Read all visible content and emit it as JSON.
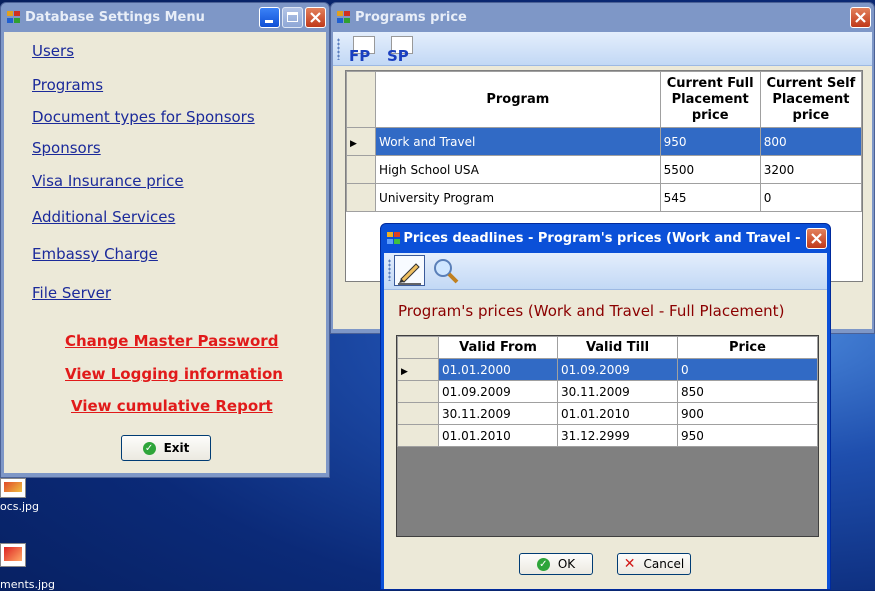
{
  "settings": {
    "title": "Database Settings Menu",
    "links": [
      "Users",
      "Programs",
      "Document types for Sponsors",
      "Sponsors",
      "Visa Insurance price",
      "Additional Services",
      "Embassy Charge",
      "File Server"
    ],
    "red_links": [
      "Change Master Password",
      "View Logging information",
      "View cumulative Report"
    ],
    "exit_label": "Exit"
  },
  "programs": {
    "title": "Programs price",
    "toolbar": [
      "FP",
      "SP"
    ],
    "columns": [
      "Program",
      "Current Full Placement price",
      "Current Self Placement price"
    ],
    "rows": [
      {
        "program": "Work and Travel",
        "full": "950",
        "self": "800"
      },
      {
        "program": "High School USA",
        "full": "5500",
        "self": "3200"
      },
      {
        "program": "University Program",
        "full": "545",
        "self": "0"
      }
    ]
  },
  "deadlines": {
    "title": "Prices deadlines -  Program's prices (Work and Travel - Full P...",
    "heading": "Program's prices (Work and Travel - Full Placement)",
    "columns": [
      "Valid From",
      "Valid Till",
      "Price"
    ],
    "rows": [
      {
        "from": "01.01.2000",
        "till": "01.09.2009",
        "price": "0"
      },
      {
        "from": "01.09.2009",
        "till": "30.11.2009",
        "price": "850"
      },
      {
        "from": "30.11.2009",
        "till": "01.01.2010",
        "price": "900"
      },
      {
        "from": "01.01.2010",
        "till": "31.12.2999",
        "price": "950"
      }
    ],
    "ok_label": "OK",
    "cancel_label": "Cancel"
  },
  "desktop": {
    "icons": [
      "ocs.jpg",
      "ments.jpg"
    ]
  },
  "colors": {
    "selection": "#316ac5",
    "link": "#1b2a9a",
    "red_link": "#e11a1a",
    "heading": "#8b0000"
  },
  "icons": [
    "minimize-icon",
    "maximize-icon",
    "close-icon",
    "edit-pencil-icon",
    "search-magnifier-icon",
    "ok-check-icon",
    "cancel-x-icon",
    "app-window-icon"
  ]
}
